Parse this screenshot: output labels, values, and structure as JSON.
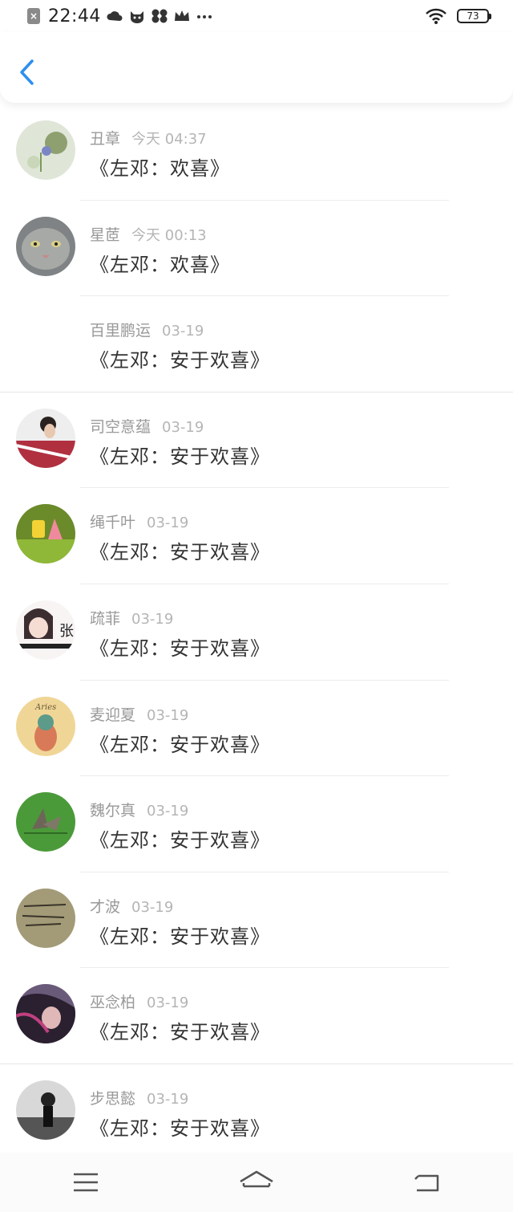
{
  "status_bar": {
    "time": "22:44",
    "battery": "73",
    "notification_icons": [
      "cloud-icon",
      "cat-icon",
      "pinwheel-icon",
      "crown-icon",
      "more-dots-icon"
    ]
  },
  "header": {
    "back_icon": "chevron-left-icon",
    "accent_color": "#2f8ef0"
  },
  "messages": [
    {
      "name": "丑章",
      "date": "今天 04:37",
      "text": "《左邓：欢喜》",
      "avatar": "flowers"
    },
    {
      "name": "星茝",
      "date": "今天 00:13",
      "text": "《左邓：欢喜》",
      "avatar": "cat"
    },
    {
      "name": "百里鹏运",
      "date": "03-19",
      "text": "《左邓：安于欢喜》",
      "avatar": "none"
    },
    {
      "name": "司空意蕴",
      "date": "03-19",
      "text": "《左邓：安于欢喜》",
      "avatar": "person-plaid"
    },
    {
      "name": "绳千叶",
      "date": "03-19",
      "text": "《左邓：安于欢喜》",
      "avatar": "cartoon-grass"
    },
    {
      "name": "疏菲",
      "date": "03-19",
      "text": "《左邓：安于欢喜》",
      "avatar": "anime-girl"
    },
    {
      "name": "麦迎夏",
      "date": "03-19",
      "text": "《左邓：安于欢喜》",
      "avatar": "aries"
    },
    {
      "name": "魏尔真",
      "date": "03-19",
      "text": "《左邓：安于欢喜》",
      "avatar": "butterfly"
    },
    {
      "name": "才波",
      "date": "03-19",
      "text": "《左邓：安于欢喜》",
      "avatar": "handwriting"
    },
    {
      "name": "巫念柏",
      "date": "03-19",
      "text": "《左邓：安于欢喜》",
      "avatar": "girl-purple"
    },
    {
      "name": "步思懿",
      "date": "03-19",
      "text": "《左邓：安于欢喜》",
      "avatar": "bw-person"
    }
  ],
  "avatar_labels": {
    "anime_text": "张",
    "aries_text": "Aries"
  },
  "nav_bar": [
    "menu-icon",
    "home-icon",
    "back-icon"
  ]
}
